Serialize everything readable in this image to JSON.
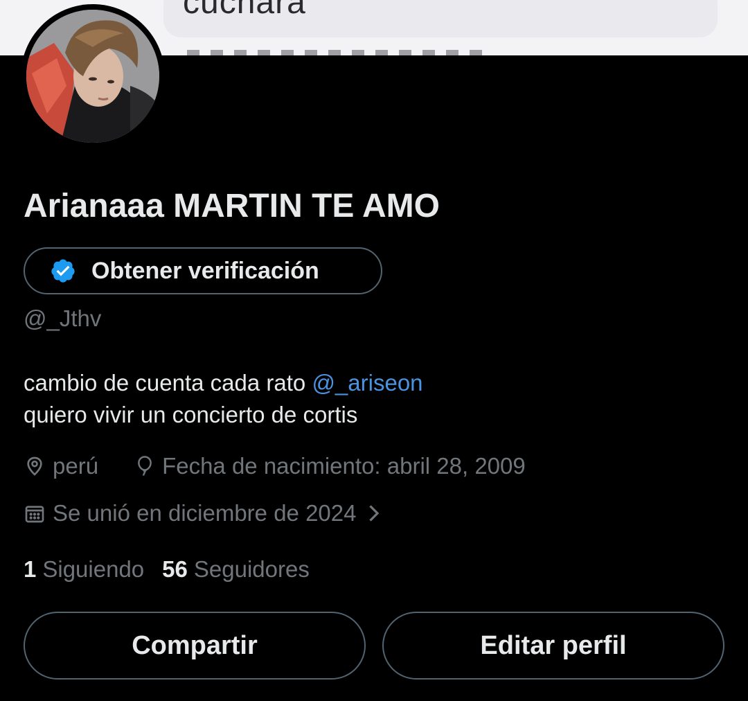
{
  "banner": {
    "partial_text": "cuchara"
  },
  "profile": {
    "display_name": "Arianaaa MARTIN TE AMO",
    "verify_label": "Obtener verificación",
    "handle": "@_Jthv",
    "bio_line1": "cambio de cuenta cada rato ",
    "bio_mention": "@_ariseon",
    "bio_line2": "quiero vivir un concierto de cortis",
    "location": "perú",
    "birthdate": "Fecha de nacimiento: abril 28, 2009",
    "joined": "Se unió en diciembre de 2024",
    "following_count": "1",
    "following_label": "Siguiendo",
    "followers_count": "56",
    "followers_label": "Seguidores"
  },
  "actions": {
    "share_label": "Compartir",
    "edit_label": "Editar perfil"
  },
  "icons": {
    "verified": "verified-badge-icon",
    "location": "location-pin-icon",
    "birthday": "balloon-icon",
    "joined": "calendar-icon",
    "chevron": "chevron-right-icon"
  },
  "colors": {
    "background": "#000000",
    "primary_text": "#e7e9ea",
    "secondary_text": "#71767b",
    "border": "#536471",
    "mention": "#4a93e0",
    "verified_badge": "#1d9bf0"
  }
}
